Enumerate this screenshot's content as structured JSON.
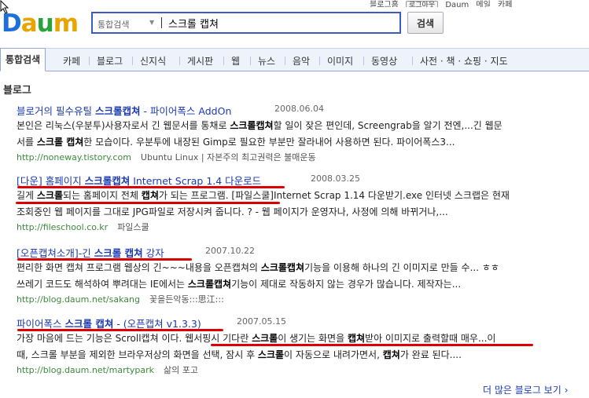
{
  "top_links": {
    "signup": "블로그홈",
    "login": "로그아웃",
    "daum": "Daum",
    "mail": "메일",
    "cafe": "카페"
  },
  "search": {
    "category": "통합검색",
    "query": "스크롤 캡쳐",
    "button": "검색"
  },
  "tabs": [
    "통합검색",
    "카페",
    "블로그",
    "신지식",
    "게시판",
    "웹",
    "뉴스",
    "음악",
    "이미지",
    "동영상",
    "사전 · 책 · 쇼핑 · 지도"
  ],
  "section_title": "블로그",
  "results": [
    {
      "title_pre": "블로거의 필수유틸 ",
      "title_bold": "스크롤캡쳐",
      "title_post": " - 파이어폭스 AddOn",
      "date": "2008.06.04",
      "line1": [
        {
          "t": "본인은 리눅스(우분투)사용자로서 긴 웹문서를 통채로 "
        },
        {
          "b": "스크롤캡쳐"
        },
        {
          "t": "할 일이 잦은 편인데, Screengrab을 알기 전엔,...긴 웹문"
        }
      ],
      "line2": [
        {
          "t": "서를 "
        },
        {
          "b": "스크롤 캡쳐"
        },
        {
          "t": "한 모습이다. 우분투에 내장된 Gimp로 필요한 부분만 잘라내어 사용하면 된다. 파이어폭스3..."
        }
      ],
      "url": "http://noneway.tistory.com",
      "meta": "Ubuntu Linux | 자본주의 최고권력은 불매운동"
    },
    {
      "title_pre": "[다운] 홈페이지 ",
      "title_bold": "스크롤캡쳐",
      "title_post": " Internet Scrap 1.4 다운로드",
      "date": "2008.03.25",
      "line1": [
        {
          "t": "길게 "
        },
        {
          "b": "스크롤"
        },
        {
          "t": "되는 홈페이지 전체 "
        },
        {
          "b": "캡쳐"
        },
        {
          "t": "가 되는 프로그램. [파일스쿨]Internet Scrap 1.14 다운받기.exe 인터넷 스크랩은 현재"
        }
      ],
      "line2": [
        {
          "t": "조회중인 웹 페이지를 그대로 JPG파일로 저장시켜 줍니다. ? - 웹 페이지가 운영자나, 사정에 의해 바뀌거나,..."
        }
      ],
      "url": "http://fileschool.co.kr",
      "meta": "파일스쿨"
    },
    {
      "title_pre": "[오픈캡쳐소개]-긴 ",
      "title_bold": "스크롤 캡쳐",
      "title_post": " 강자",
      "date": "2007.10.22",
      "line1": [
        {
          "t": "편리한 화면 캡쳐 프로그램 웹상의 긴~~~내용을 오픈캡쳐의 "
        },
        {
          "b": "스크롤캡쳐"
        },
        {
          "t": "기능을 이용해 하나의 긴 이미지로 만들 수... ㅎㅎ"
        }
      ],
      "line2": [
        {
          "t": "쓰레기 코드도 해석하여 뿌려대는 IE에서는 "
        },
        {
          "b": "스크롤캡쳐"
        },
        {
          "t": "기능이 제대로 작동하지 않는 경우가 많습니다. 제작자는..."
        }
      ],
      "url": "http://blog.daum.net/sakang",
      "meta": "꽃을든악동:::思江:::"
    },
    {
      "title_pre": "파이어폭스 ",
      "title_bold": "스크롤 캡쳐",
      "title_post": " - (오픈캡쳐 v1.3.3)",
      "date": "2007.05.15",
      "line1": [
        {
          "t": "가장 마음에 드는 기능은 Scroll캡쳐 이다. 웹서핑시 기다란 "
        },
        {
          "b": "스크롤"
        },
        {
          "t": "이 생기는 화면을 "
        },
        {
          "b": "캡쳐"
        },
        {
          "t": "받아 이미지로 출력할때 매우...이"
        }
      ],
      "line2": [
        {
          "t": "때, 스크롤 부분을 제외한 브라우저상의 화면을 선택, 잠시 후 "
        },
        {
          "b": "스크롤"
        },
        {
          "t": "이 자동으로 내려가면서, "
        },
        {
          "b": "캡쳐"
        },
        {
          "t": "가 완료 된다...."
        }
      ],
      "url": "http://blog.daum.net/martypark",
      "meta": "삶의 포고"
    }
  ],
  "more_link": "더 많은 블로그 보기",
  "colors": {
    "brand_blue": "#1d6fd9",
    "link": "#1a3ab0",
    "url_green": "#3b8a3b",
    "highlight": "#dd0000"
  }
}
